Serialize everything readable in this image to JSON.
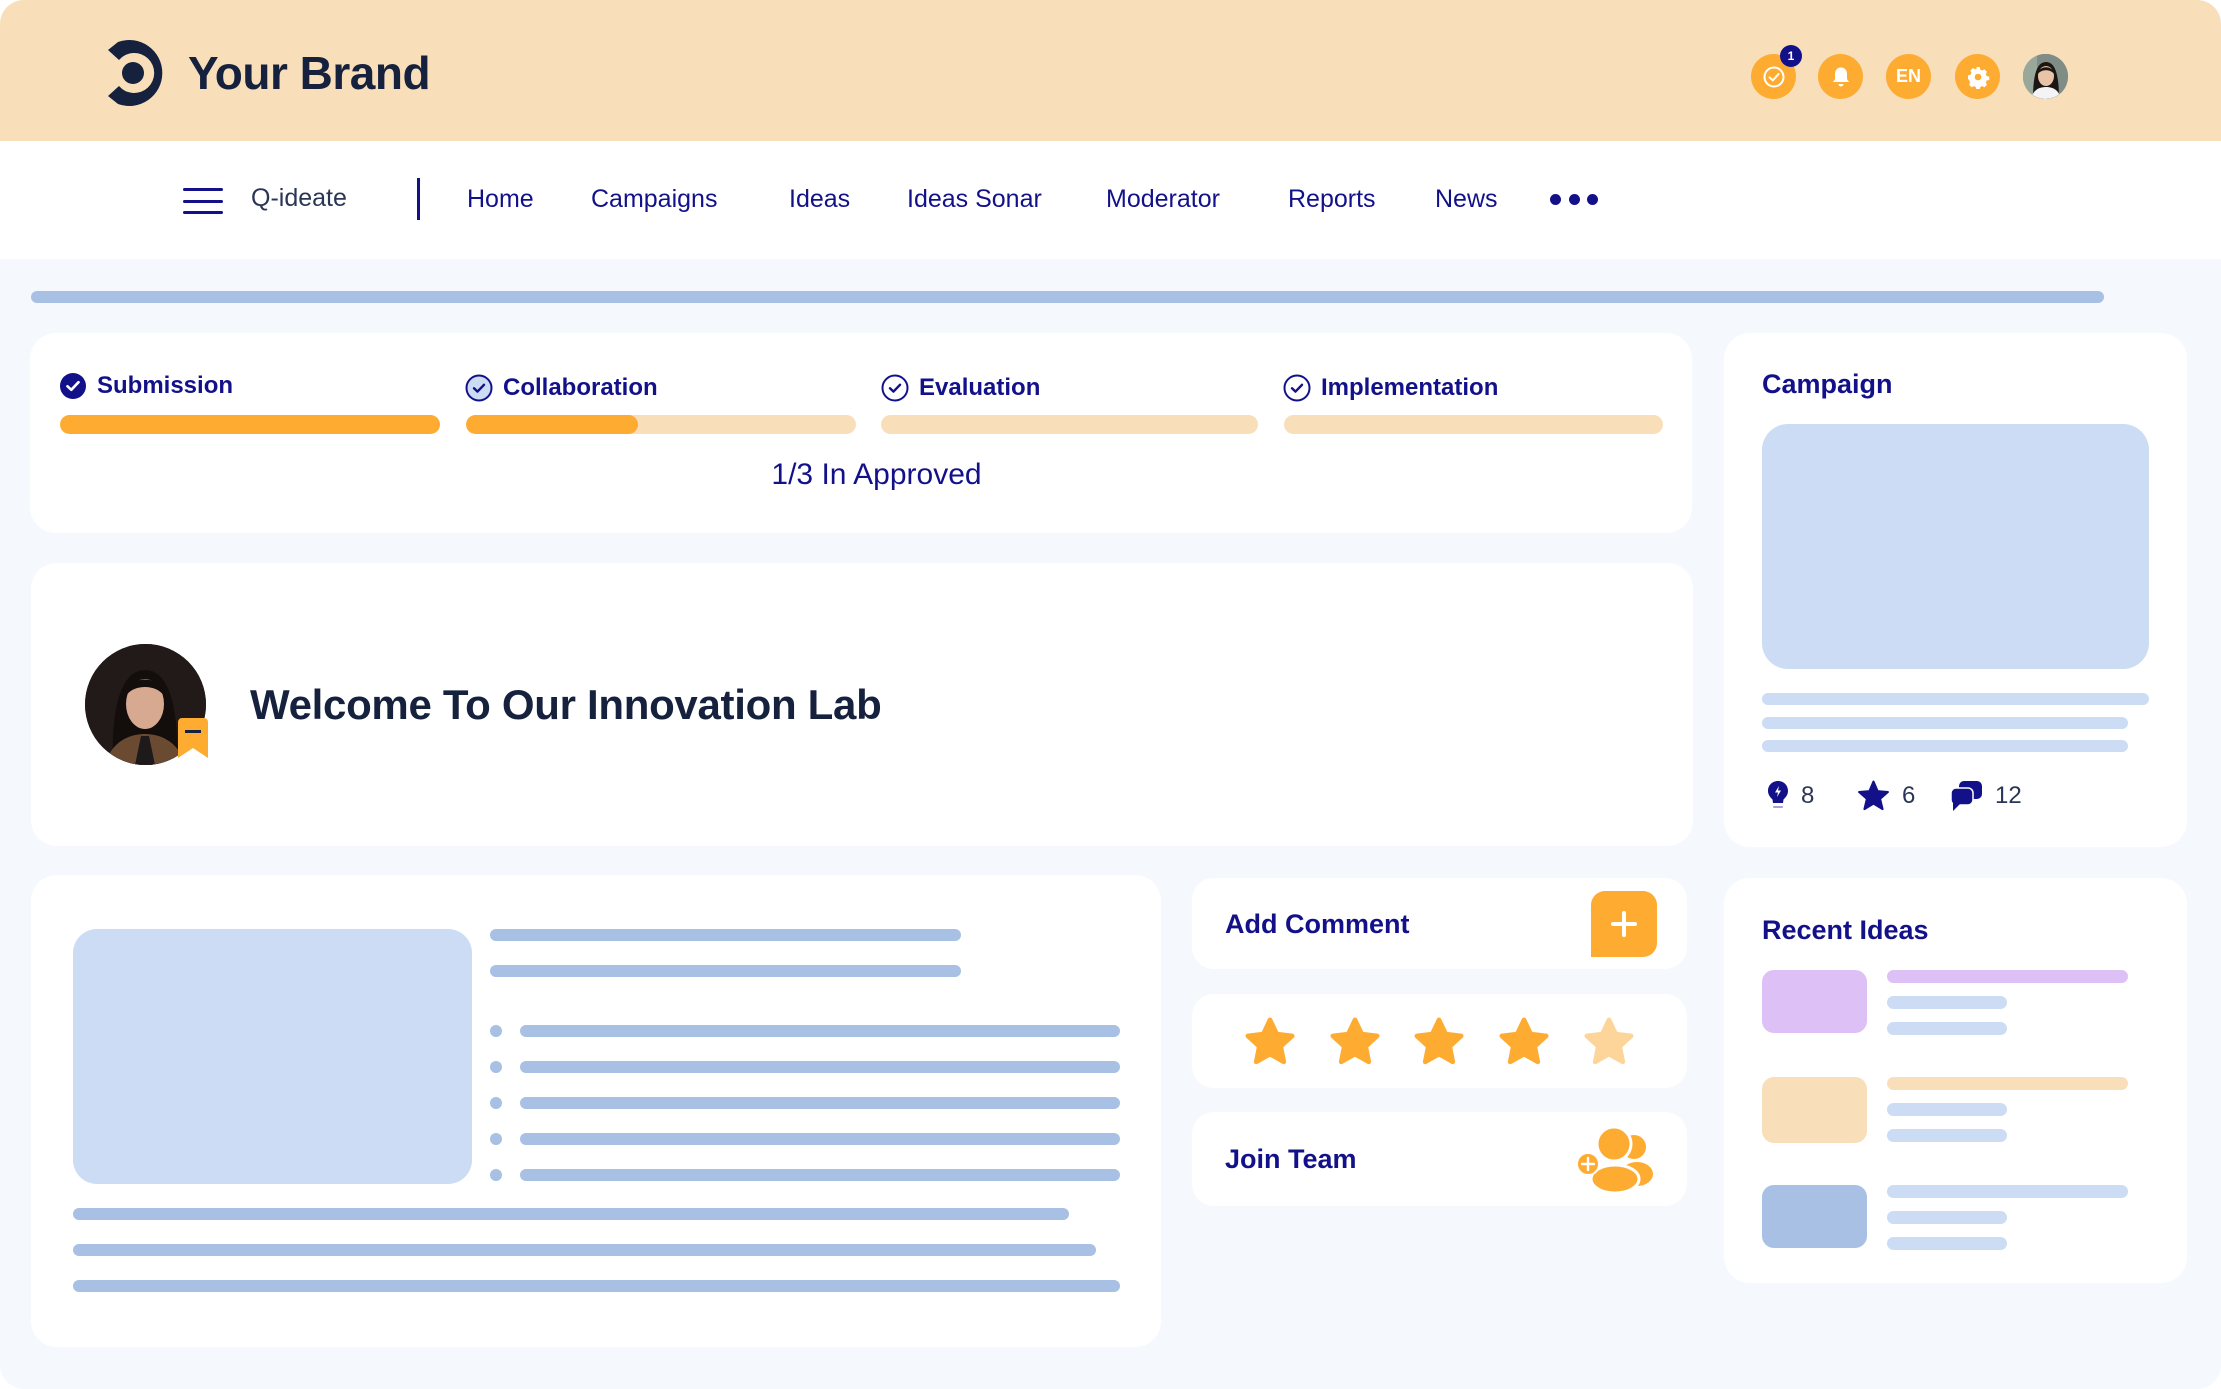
{
  "header": {
    "brand": "Your Brand",
    "icons": [
      {
        "name": "check-circle-icon",
        "badge": "1"
      },
      {
        "name": "bell-icon"
      },
      {
        "name": "language-button",
        "label": "EN"
      },
      {
        "name": "gear-icon"
      },
      {
        "name": "user-avatar"
      }
    ]
  },
  "nav": {
    "app_name": "Q-ideate",
    "items": [
      "Home",
      "Campaigns",
      "Ideas",
      "Ideas Sonar",
      "Moderator",
      "Reports",
      "News"
    ],
    "more_icon": "more-horizontal-icon"
  },
  "progress": {
    "stages": [
      {
        "label": "Submission",
        "progress": 1.0,
        "state": "complete"
      },
      {
        "label": "Collaboration",
        "progress": 0.44,
        "state": "active"
      },
      {
        "label": "Evaluation",
        "progress": 0.0,
        "state": "pending"
      },
      {
        "label": "Implementation",
        "progress": 0.0,
        "state": "pending"
      }
    ],
    "status": "1/3 In Approved"
  },
  "welcome": {
    "title": "Welcome To Our Innovation Lab"
  },
  "campaign": {
    "title": "Campaign",
    "stats": [
      {
        "icon": "lightbulb-icon",
        "value": "8"
      },
      {
        "icon": "star-icon",
        "value": "6"
      },
      {
        "icon": "comments-icon",
        "value": "12"
      }
    ]
  },
  "actions": {
    "add_comment": "Add Comment",
    "join_team": "Join Team",
    "rating": 4,
    "rating_max": 5
  },
  "recent_ideas": {
    "title": "Recent Ideas",
    "items": [
      {
        "color": "#ddc0f5",
        "title_color": "#ddc0f5"
      },
      {
        "color": "#f8dfba",
        "title_color": "#f8dfba"
      },
      {
        "color": "#a8c0e4",
        "title_color": "#cbdcf4"
      }
    ]
  },
  "colors": {
    "accent": "#fdab31",
    "accent_light": "#f8dfba",
    "navy": "#13118a",
    "brand_text": "#16213e",
    "placeholder": "#cbdcf4",
    "placeholder_dark": "#a8c0e4"
  }
}
